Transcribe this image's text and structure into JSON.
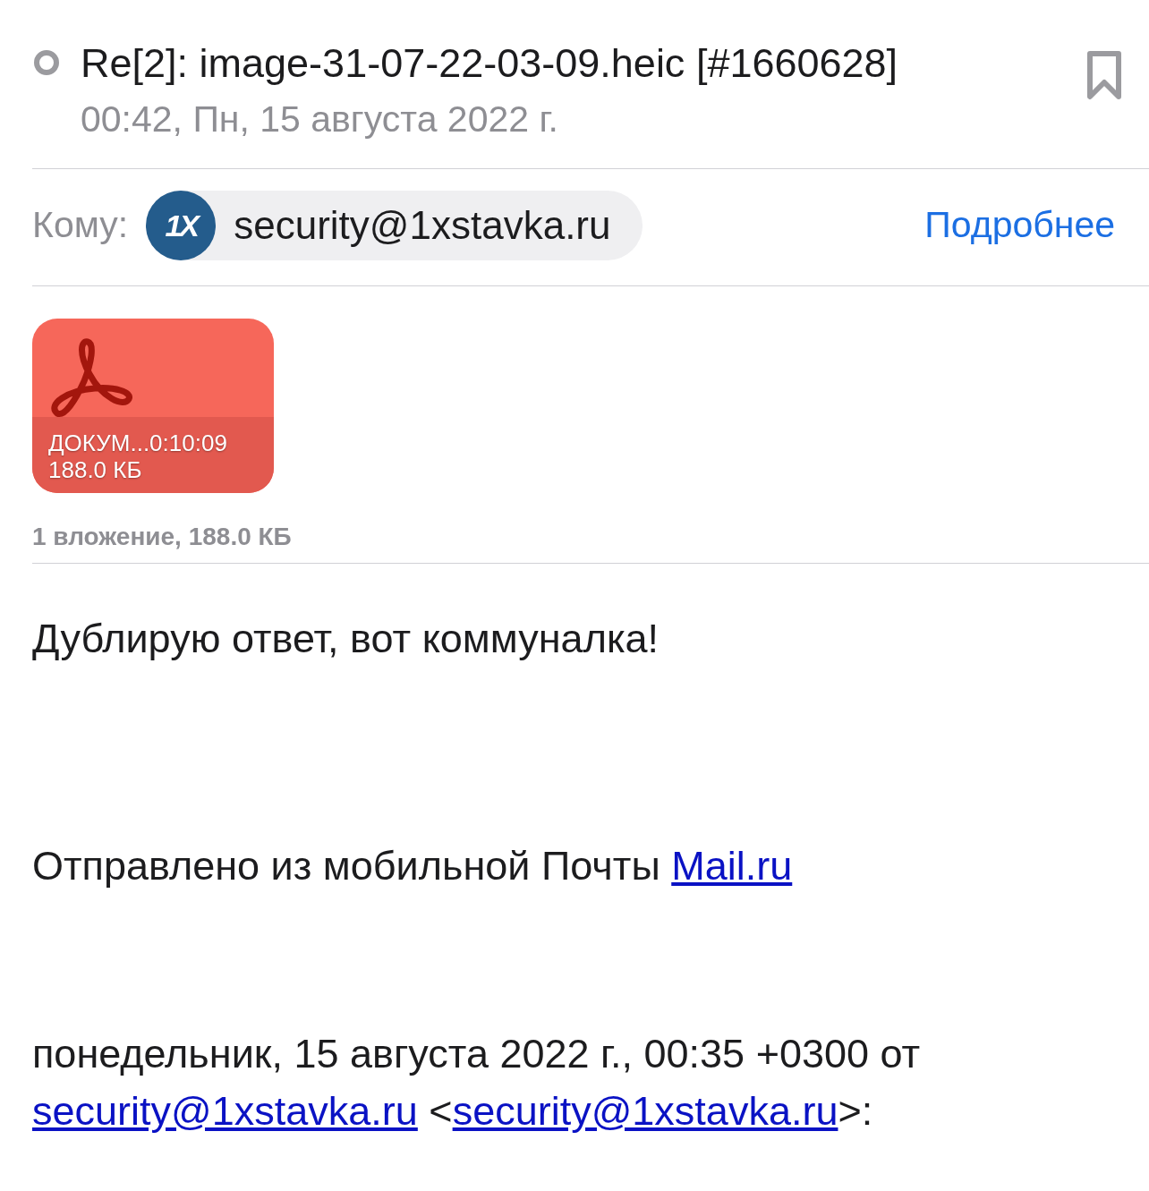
{
  "header": {
    "subject": "Re[2]: image-31-07-22-03-09.heic [#1660628]",
    "date": "00:42, Пн, 15 августа 2022 г.",
    "bookmarked": false
  },
  "recipients": {
    "label": "Кому:",
    "contact": {
      "avatar_text": "1X",
      "email": "security@1xstavka.ru"
    },
    "details_link": "Подробнее"
  },
  "attachments": [
    {
      "name": "ДОКУМ...0:10:09",
      "size": "188.0 КБ"
    }
  ],
  "attachments_summary": "1 вложение, 188.0 КБ",
  "body": [
    [
      {
        "kind": "text",
        "text": "Дублирую ответ, вот коммуналка!"
      }
    ],
    [
      {
        "kind": "text",
        "text": "Отправлено из мобильной Почты "
      },
      {
        "kind": "link",
        "text": "Mail.ru"
      }
    ],
    [
      {
        "kind": "text",
        "text": "понедельник, 15 августа 2022 г., 00:35 +0300 от "
      },
      {
        "kind": "link",
        "text": "security@1xstavka.ru"
      },
      {
        "kind": "text",
        "text": " <"
      },
      {
        "kind": "link",
        "text": "security@1xstavka.ru"
      },
      {
        "kind": "text",
        "text": ">:"
      }
    ]
  ]
}
